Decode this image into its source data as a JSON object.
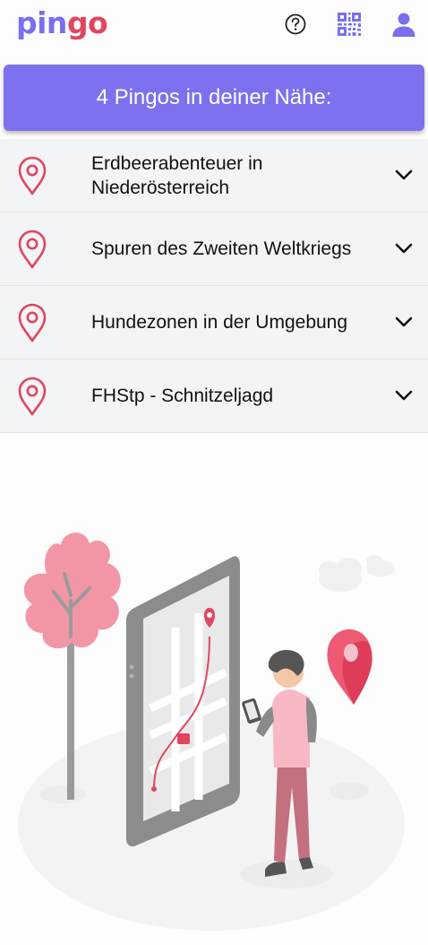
{
  "header": {
    "logo": {
      "part1": "pin",
      "part2": "go"
    },
    "icons": [
      "help-icon",
      "qr-code-icon",
      "user-icon"
    ]
  },
  "banner": {
    "text": "4 Pingos in deiner Nähe:"
  },
  "list": {
    "items": [
      {
        "title": "Erdbeerabenteuer in Niederösterreich"
      },
      {
        "title": "Spuren des Zweiten Weltkriegs"
      },
      {
        "title": "Hundezonen in der Umgebung"
      },
      {
        "title": "FHStp - Schnitzeljagd"
      }
    ]
  },
  "colors": {
    "primary": "#7d70ee",
    "accent": "#e0465f",
    "row_bg": "#f3f4f6"
  }
}
